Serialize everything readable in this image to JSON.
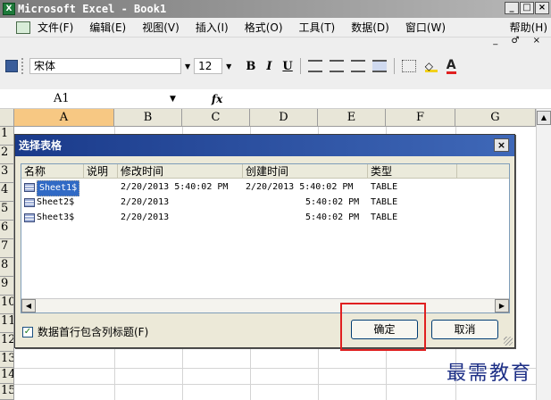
{
  "window": {
    "title": "Microsoft Excel - Book1",
    "app_icon": "excel-icon",
    "buttons": [
      "_",
      "□",
      "×"
    ]
  },
  "menu": {
    "items": [
      "文件(F)",
      "编辑(E)",
      "视图(V)",
      "插入(I)",
      "格式(O)",
      "工具(T)",
      "数据(D)",
      "窗口(W)"
    ],
    "help": "帮助(H)",
    "doc_controls": "_ ♂ ×"
  },
  "toolbar": {
    "font": "宋体",
    "size": "12",
    "bold": "B",
    "italic": "I",
    "underline": "U",
    "font_color": "A"
  },
  "formula_bar": {
    "cell_ref": "A1",
    "fx": "fx"
  },
  "grid": {
    "columns": [
      "A",
      "B",
      "C",
      "D",
      "E",
      "F",
      "G"
    ],
    "rows": [
      "1",
      "2",
      "3",
      "4",
      "5",
      "6",
      "7",
      "8",
      "9",
      "10",
      "11",
      "12",
      "13",
      "14",
      "15"
    ]
  },
  "dialog": {
    "title": "选择表格",
    "close": "×",
    "columns": [
      "名称",
      "说明",
      "修改时间",
      "创建时间",
      "类型"
    ],
    "rows": [
      {
        "name": "Sheet1$",
        "modified": "2/20/2013 5:40:02 PM",
        "created": "2/20/2013 5:40:02 PM",
        "type": "TABLE"
      },
      {
        "name": "Sheet2$",
        "modified": "2/20/2013",
        "created": "5:40:02 PM",
        "type": "TABLE"
      },
      {
        "name": "Sheet3$",
        "modified": "2/20/2013",
        "created": "5:40:02 PM",
        "type": "TABLE"
      }
    ],
    "checkbox_label": "数据首行包含列标题(F)",
    "ok": "确定",
    "cancel": "取消"
  },
  "watermark": "最需教育"
}
